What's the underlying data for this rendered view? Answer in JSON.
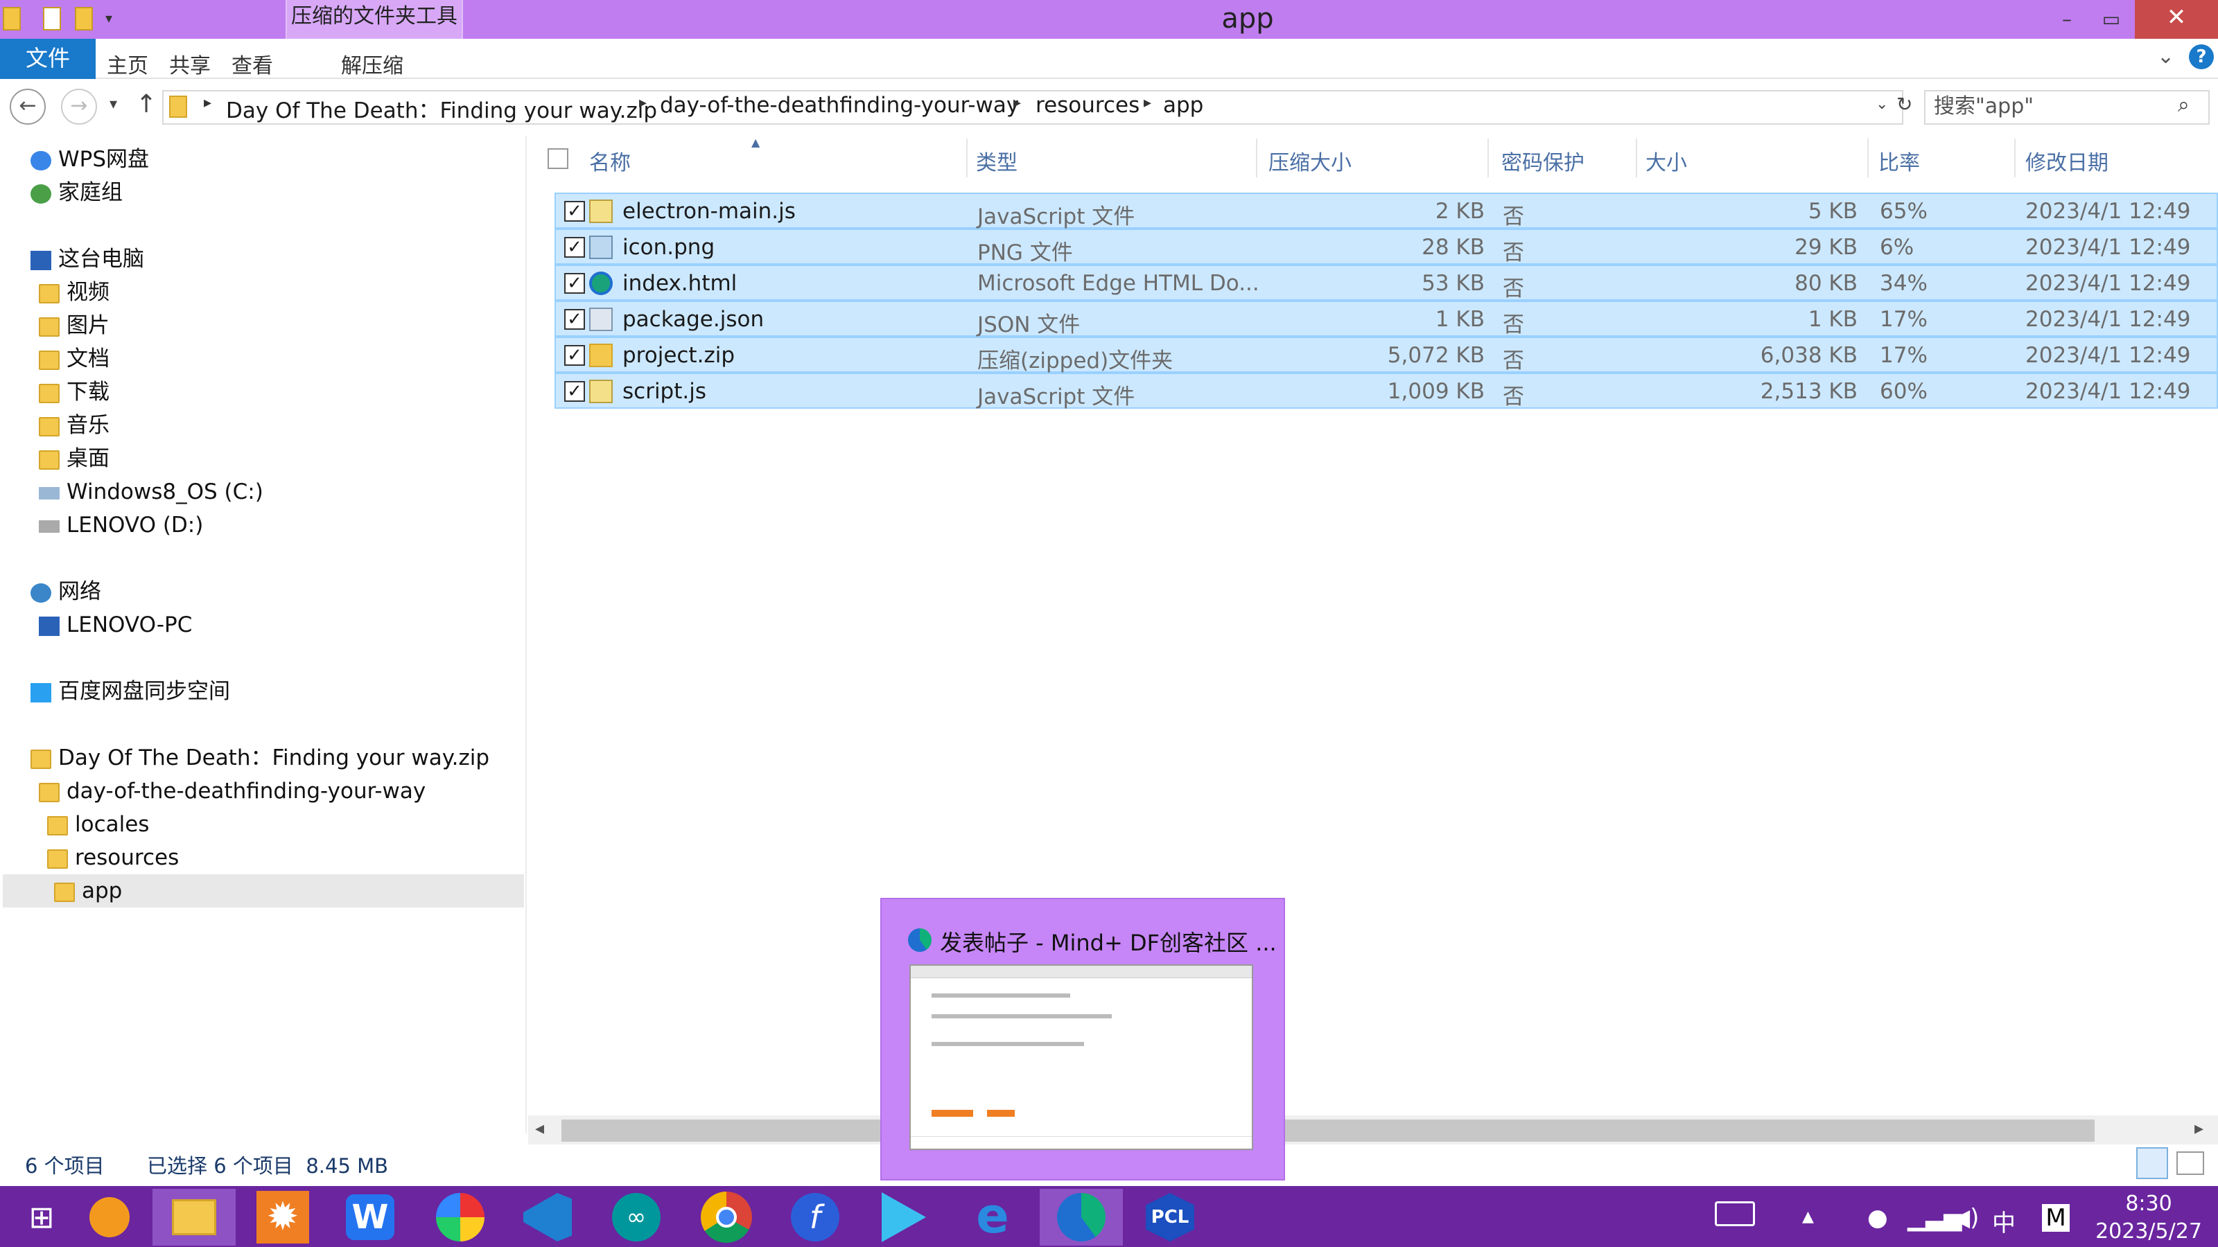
{
  "titlebar": {
    "context_tab": "压缩的文件夹工具",
    "window_title": "app",
    "minimize": "–",
    "restore": "▭",
    "close": "✕"
  },
  "ribbon": {
    "file_tab": "文件",
    "tabs": [
      "主页",
      "共享",
      "查看",
      "解压缩"
    ]
  },
  "address": {
    "crumbs": [
      "Day Of The Death：Finding your way.zip",
      "day-of-the-deathfinding-your-way",
      "resources",
      "app"
    ],
    "search_placeholder": "搜索\"app\""
  },
  "nav": {
    "items": [
      {
        "label": "WPS网盘",
        "icon": "cloud-icon"
      },
      {
        "label": "家庭组",
        "icon": "homegroup-icon"
      },
      {
        "label": "这台电脑",
        "icon": "computer-icon"
      },
      {
        "label": "视频",
        "icon": "folder-icon"
      },
      {
        "label": "图片",
        "icon": "folder-icon"
      },
      {
        "label": "文档",
        "icon": "folder-icon"
      },
      {
        "label": "下载",
        "icon": "folder-icon"
      },
      {
        "label": "音乐",
        "icon": "folder-icon"
      },
      {
        "label": "桌面",
        "icon": "folder-icon"
      },
      {
        "label": "Windows8_OS (C:)",
        "icon": "drive-icon"
      },
      {
        "label": "LENOVO (D:)",
        "icon": "drive-icon"
      },
      {
        "label": "网络",
        "icon": "network-icon"
      },
      {
        "label": "LENOVO-PC",
        "icon": "computer-icon"
      },
      {
        "label": "百度网盘同步空间",
        "icon": "baidu-icon"
      },
      {
        "label": "Day Of The Death：Finding your way.zip",
        "icon": "zip-icon"
      },
      {
        "label": "day-of-the-deathfinding-your-way",
        "icon": "folder-icon"
      },
      {
        "label": "locales",
        "icon": "folder-icon"
      },
      {
        "label": "resources",
        "icon": "folder-icon"
      },
      {
        "label": "app",
        "icon": "folder-icon"
      }
    ]
  },
  "columns": [
    "名称",
    "类型",
    "压缩大小",
    "密码保护",
    "大小",
    "比率",
    "修改日期"
  ],
  "files": [
    {
      "name": "electron-main.js",
      "type": "JavaScript 文件",
      "csize": "2 KB",
      "pw": "否",
      "size": "5 KB",
      "ratio": "65%",
      "date": "2023/4/1 12:49",
      "icon": "js-file-icon"
    },
    {
      "name": "icon.png",
      "type": "PNG 文件",
      "csize": "28 KB",
      "pw": "否",
      "size": "29 KB",
      "ratio": "6%",
      "date": "2023/4/1 12:49",
      "icon": "png-file-icon"
    },
    {
      "name": "index.html",
      "type": "Microsoft Edge HTML Do...",
      "csize": "53 KB",
      "pw": "否",
      "size": "80 KB",
      "ratio": "34%",
      "date": "2023/4/1 12:49",
      "icon": "edge-html-icon"
    },
    {
      "name": "package.json",
      "type": "JSON 文件",
      "csize": "1 KB",
      "pw": "否",
      "size": "1 KB",
      "ratio": "17%",
      "date": "2023/4/1 12:49",
      "icon": "json-file-icon"
    },
    {
      "name": "project.zip",
      "type": "压缩(zipped)文件夹",
      "csize": "5,072 KB",
      "pw": "否",
      "size": "6,038 KB",
      "ratio": "17%",
      "date": "2023/4/1 12:49",
      "icon": "zip-file-icon"
    },
    {
      "name": "script.js",
      "type": "JavaScript 文件",
      "csize": "1,009 KB",
      "pw": "否",
      "size": "2,513 KB",
      "ratio": "60%",
      "date": "2023/4/1 12:49",
      "icon": "js-file-icon"
    }
  ],
  "status": {
    "count": "6 个项目",
    "selected": "已选择 6 个项目  8.45 MB"
  },
  "thumbnail": {
    "title": "发表帖子 - Mind+ DF创客社区 ..."
  },
  "taskbar": {
    "time": "8:30",
    "date": "2023/5/27",
    "ime": "中",
    "ime2": "M"
  }
}
